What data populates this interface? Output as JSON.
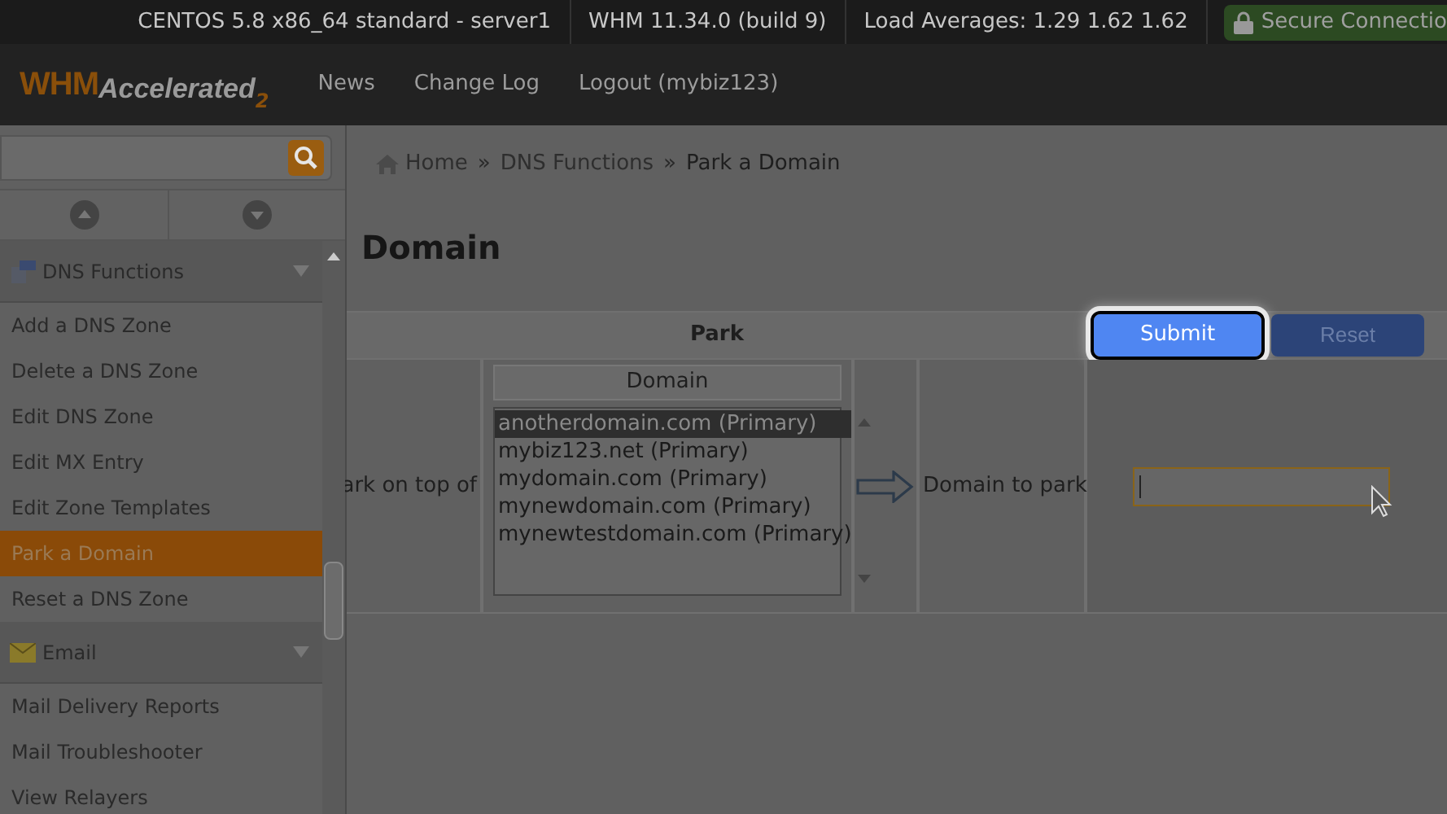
{
  "top_bar": {
    "items": [
      "CENTOS 5.8 x86_64 standard - server1",
      "WHM 11.34.0 (build 9)",
      "Load Averages: 1.29 1.62 1.62"
    ],
    "secure": "Secure Connectio"
  },
  "header": {
    "logo": "WHM",
    "logo_sub": "Accelerated",
    "logo_version": "2",
    "links": [
      "News",
      "Change Log",
      "Logout (mybiz123)"
    ]
  },
  "breadcrumb": {
    "separator": "»",
    "items": [
      "Home",
      "DNS Functions",
      "Park a Domain"
    ]
  },
  "sidebar": {
    "sections": [
      {
        "title": "DNS Functions",
        "items": [
          {
            "label": "Add a DNS Zone",
            "selected": false
          },
          {
            "label": "Delete a DNS Zone",
            "selected": false
          },
          {
            "label": "Edit DNS Zone",
            "selected": false
          },
          {
            "label": "Edit MX Entry",
            "selected": false
          },
          {
            "label": "Edit Zone Templates",
            "selected": false
          },
          {
            "label": "Park a Domain",
            "selected": true
          },
          {
            "label": "Reset a DNS Zone",
            "selected": false
          }
        ]
      },
      {
        "title": "Email",
        "items": [
          {
            "label": "Mail Delivery Reports",
            "selected": false
          },
          {
            "label": "Mail Troubleshooter",
            "selected": false
          },
          {
            "label": "View Relayers",
            "selected": false
          }
        ]
      }
    ]
  },
  "page_title": "Domain",
  "form": {
    "header": "Park",
    "buttons": [
      {
        "label": "Submit",
        "highlighted": true
      },
      {
        "label": "Reset",
        "highlighted": false
      }
    ],
    "row_label": "ark on top of",
    "list_header": "Domain",
    "domains": [
      {
        "label": "anotherdomain.com (Primary)",
        "selected": true
      },
      {
        "label": "mybiz123.net (Primary)",
        "selected": false
      },
      {
        "label": "mydomain.com (Primary)",
        "selected": false
      },
      {
        "label": "mynewdomain.com (Primary)",
        "selected": false
      },
      {
        "label": "mynewtestdomain.com (Primary)",
        "selected": false
      }
    ],
    "park_label": "Domain to park"
  }
}
